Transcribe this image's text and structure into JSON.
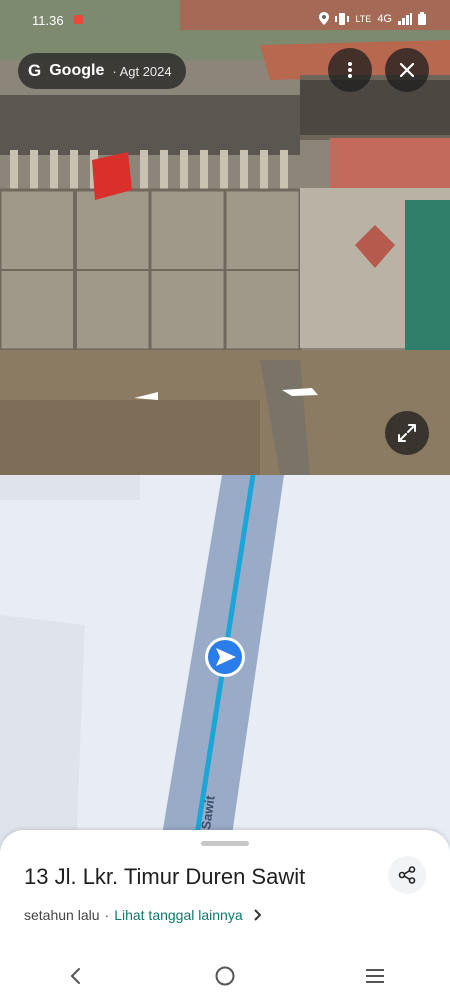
{
  "status_bar": {
    "time": "11.36",
    "network": "4G",
    "lte": "LTE"
  },
  "image_info": {
    "brand": "Google",
    "date": "· Agt 2024"
  },
  "map": {
    "street_label": "Sawit"
  },
  "location": {
    "title": "13 Jl. Lkr. Timur Duren Sawit",
    "age": "setahun lalu",
    "separator": "·",
    "other_dates_link": "Lihat tanggal lainnya"
  },
  "icons": {
    "more": "more-vert-icon",
    "close": "close-icon",
    "expand": "expand-icon",
    "share": "share-icon",
    "direction": "navigation-arrow-icon",
    "back": "back-icon",
    "home": "home-icon",
    "recents": "recents-icon"
  },
  "colors": {
    "accent_link": "#0b7a6e",
    "route_line": "#1aa6d8",
    "direction_marker": "#2b7de9"
  }
}
